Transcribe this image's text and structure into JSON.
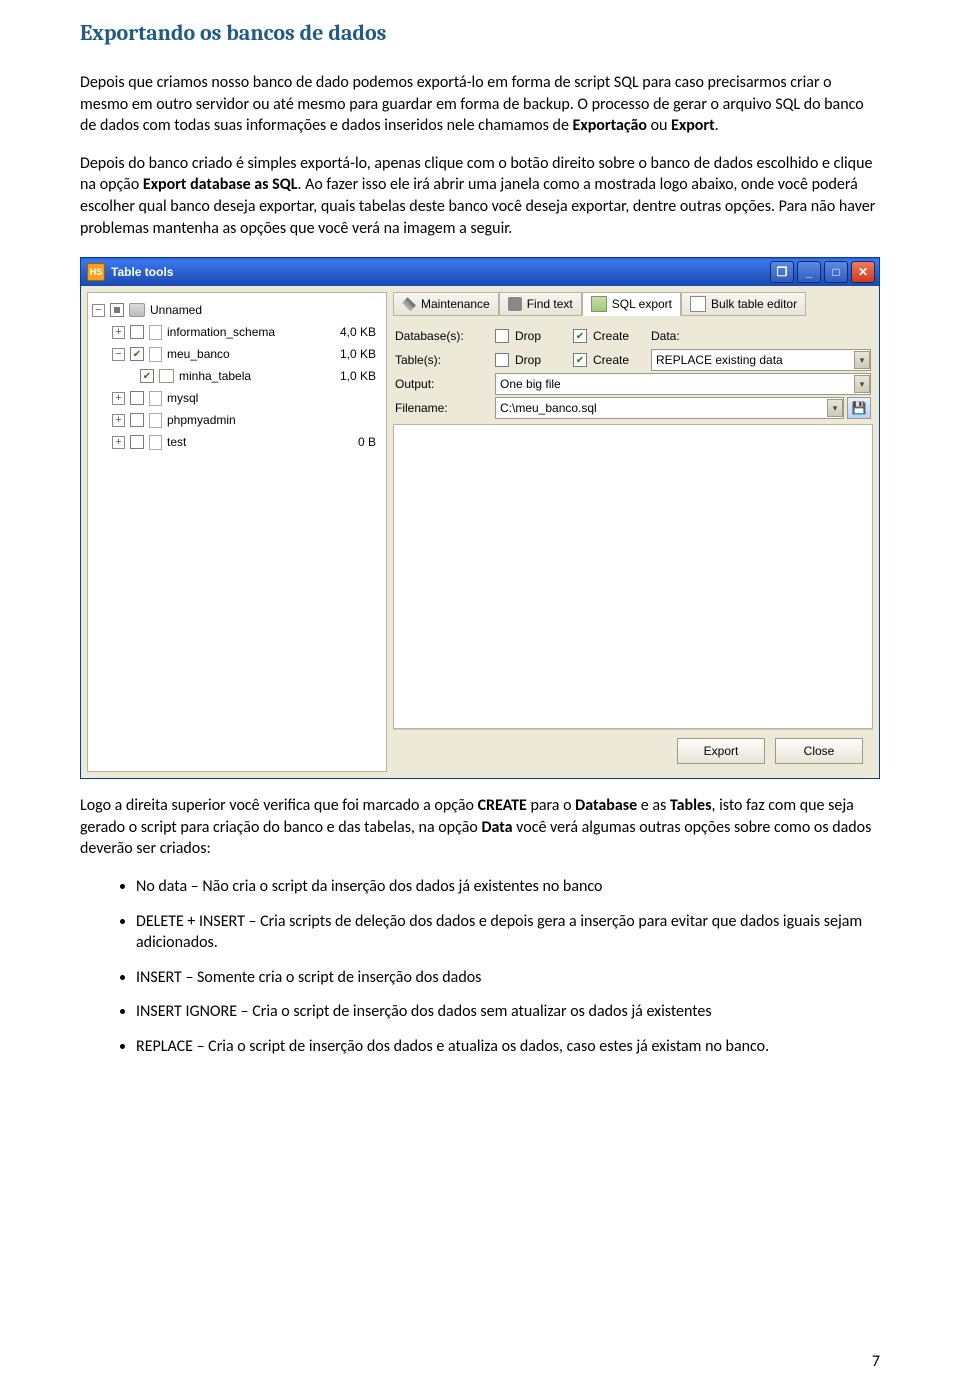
{
  "doc": {
    "section_title": "Exportando os bancos de dados",
    "para1_a": "Depois que criamos nosso banco de dado podemos exportá-lo em forma de script SQL para caso precisarmos criar o mesmo em outro servidor ou até mesmo para guardar em forma de backup. O processo de gerar o arquivo SQL do banco de dados com todas suas informações e dados inseridos nele chamamos de ",
    "para1_b": "Exportação",
    "para1_c": " ou ",
    "para1_d": "Export",
    "para1_e": ".",
    "para2_a": "Depois do banco criado é simples exportá-lo, apenas clique com o botão direito sobre o banco de dados escolhido e clique na opção ",
    "para2_b": "Export database as SQL",
    "para2_c": ". Ao fazer isso ele irá abrir uma janela como a mostrada logo abaixo, onde você poderá escolher qual banco deseja exportar, quais tabelas deste banco você deseja exportar, dentre outras opções. Para não haver problemas mantenha as opções que você verá na imagem a seguir.",
    "para3_a": "Logo a direita superior você verifica que foi marcado a opção ",
    "para3_b": "CREATE",
    "para3_c": " para o ",
    "para3_d": "Database",
    "para3_e": " e as ",
    "para3_f": "Tables",
    "para3_g": ", isto faz com que seja gerado o script para criação do banco e das tabelas, na opção ",
    "para3_h": "Data",
    "para3_i": " você verá algumas outras opções sobre como os dados deverão ser criados:",
    "bullets": [
      "No data – Não cria o script da inserção dos dados já existentes no banco",
      "DELETE + INSERT – Cria scripts de deleção dos dados e depois gera a inserção para evitar que dados iguais sejam adicionados.",
      "INSERT – Somente cria o script de inserção dos dados",
      "INSERT IGNORE – Cria o script de inserção dos dados sem atualizar os dados já existentes",
      "REPLACE – Cria o script de inserção dos dados e atualiza os dados, caso estes já existam no banco."
    ],
    "page_no": "7"
  },
  "win": {
    "title": "Table tools",
    "badge": "HS",
    "min": "_",
    "max": "□",
    "close": "✕",
    "tree": [
      {
        "expand": "−",
        "check": "semi",
        "icon": "db",
        "label": "Unnamed",
        "size": "",
        "indent": 0
      },
      {
        "expand": "+",
        "check": "",
        "icon": "sheet",
        "label": "information_schema",
        "size": "4,0 KB",
        "indent": 1
      },
      {
        "expand": "−",
        "check": "chk",
        "icon": "sheet",
        "label": "meu_banco",
        "size": "1,0 KB",
        "indent": 1
      },
      {
        "expand": "",
        "check": "chk",
        "icon": "table",
        "label": "minha_tabela",
        "size": "1,0 KB",
        "indent": 2
      },
      {
        "expand": "+",
        "check": "",
        "icon": "sheet",
        "label": "mysql",
        "size": "",
        "indent": 1
      },
      {
        "expand": "+",
        "check": "",
        "icon": "sheet",
        "label": "phpmyadmin",
        "size": "",
        "indent": 1
      },
      {
        "expand": "+",
        "check": "",
        "icon": "sheet",
        "label": "test",
        "size": "0 B",
        "indent": 1
      }
    ],
    "tabs": {
      "maintenance": "Maintenance",
      "findtext": "Find text",
      "sqlexport": "SQL export",
      "bulk": "Bulk table editor"
    },
    "form": {
      "databases_label": "Database(s):",
      "tables_label": "Table(s):",
      "output_label": "Output:",
      "filename_label": "Filename:",
      "drop": "Drop",
      "create": "Create",
      "data": "Data:",
      "select_data": "REPLACE existing data",
      "select_output": "One big file",
      "filename_value": "C:\\meu_banco.sql"
    },
    "buttons": {
      "export": "Export",
      "close": "Close"
    }
  }
}
